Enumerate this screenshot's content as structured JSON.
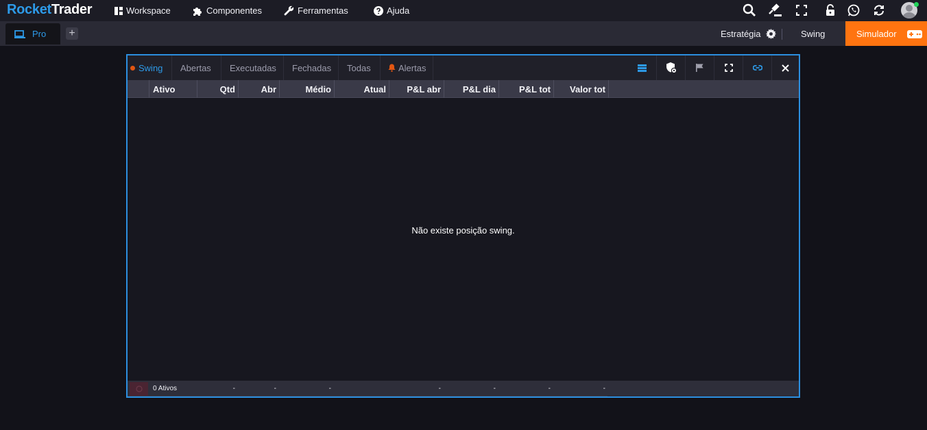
{
  "app": {
    "logo_part1": "Rocket",
    "logo_part2": "Trader"
  },
  "menu": {
    "workspace": "Workspace",
    "componentes": "Componentes",
    "ferramentas": "Ferramentas",
    "ajuda": "Ajuda"
  },
  "top_icons": [
    "search-icon",
    "gavel-icon",
    "fullscreen-icon",
    "lock-icon",
    "whatsapp-icon",
    "sync-icon",
    "avatar"
  ],
  "workspace_tabs": [
    {
      "label": "Pro",
      "active": true
    }
  ],
  "subbar": {
    "strategy_label": "Estratégia",
    "mode_label": "Swing",
    "simulator_label": "Simulador"
  },
  "panel": {
    "tabs": [
      {
        "label": "Swing",
        "active": true
      },
      {
        "label": "Abertas"
      },
      {
        "label": "Executadas"
      },
      {
        "label": "Fechadas"
      },
      {
        "label": "Todas"
      },
      {
        "label": "Alertas"
      }
    ],
    "columns": [
      "Ativo",
      "Qtd",
      "Abr",
      "Médio",
      "Atual",
      "P&L abr",
      "P&L dia",
      "P&L tot",
      "Valor tot"
    ],
    "empty_message": "Não existe posição swing.",
    "footer": {
      "count": "0 Ativos",
      "qtd": "-",
      "abr": "-",
      "medio": "-",
      "pl_abr": "-",
      "pl_dia": "-",
      "pl_tot": "-",
      "valor_tot": "-"
    }
  },
  "colors": {
    "accent": "#2d9ae8",
    "simulator": "#ff7410",
    "alert": "#e25612",
    "background": "#121219"
  }
}
